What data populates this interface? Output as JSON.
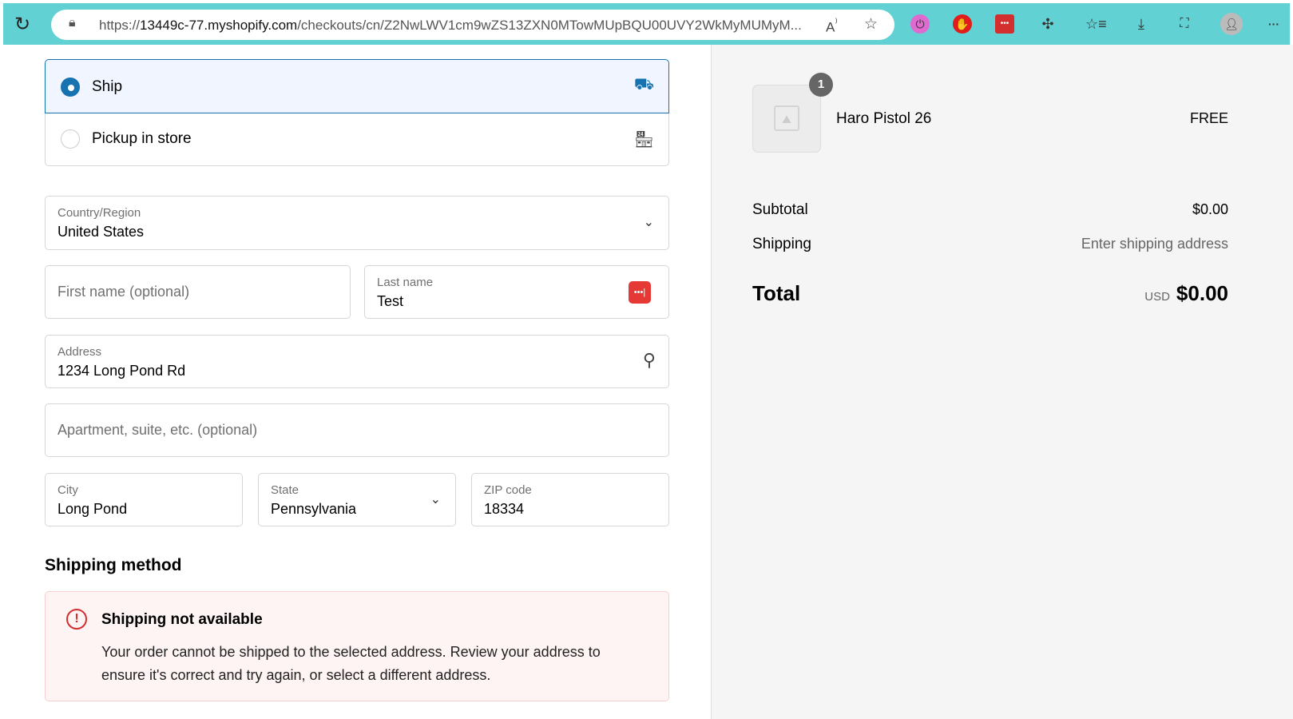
{
  "browser": {
    "url_prefix": "https://",
    "url_domain": "13449c-77.myshopify.com",
    "url_path": "/checkouts/cn/Z2NwLWV1cm9wZS13ZXN0MTowMUpBQU00UVY2WkMyMUMyM...",
    "read_aloud": "A⁾"
  },
  "delivery": {
    "options": [
      {
        "label": "Ship",
        "selected": true
      },
      {
        "label": "Pickup in store",
        "selected": false
      }
    ]
  },
  "form": {
    "country": {
      "label": "Country/Region",
      "value": "United States"
    },
    "first_name": {
      "placeholder": "First name (optional)"
    },
    "last_name": {
      "label": "Last name",
      "value": "Test"
    },
    "address": {
      "label": "Address",
      "value": "1234 Long Pond Rd"
    },
    "apartment": {
      "placeholder": "Apartment, suite, etc. (optional)"
    },
    "city": {
      "label": "City",
      "value": "Long Pond"
    },
    "state": {
      "label": "State",
      "value": "Pennsylvania"
    },
    "zip": {
      "label": "ZIP code",
      "value": "18334"
    }
  },
  "shipping_method": {
    "heading": "Shipping method",
    "error_title": "Shipping not available",
    "error_body_1": "Your order cannot be shipped to the selected address. Review your address to",
    "error_body_2": "ensure it's correct and try again, or select a different address."
  },
  "summary": {
    "item": {
      "quantity": "1",
      "name": "Haro Pistol 26",
      "price": "FREE"
    },
    "subtotal_label": "Subtotal",
    "subtotal": "$0.00",
    "shipping_label": "Shipping",
    "shipping": "Enter shipping address",
    "total_label": "Total",
    "currency": "USD",
    "total": "$0.00"
  }
}
